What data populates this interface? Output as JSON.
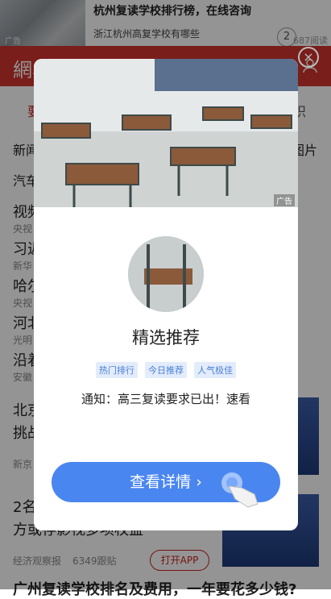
{
  "top_ad": {
    "title": "杭州复读学校排行榜，在线咨询",
    "subtitle": "浙江杭州高复学校有哪些",
    "ad_tag": "广告",
    "read_count": "687阅读",
    "badge_number": "2"
  },
  "header": {
    "logo_text": "網易"
  },
  "tabs": {
    "left_partial": "要",
    "right_partial": "织"
  },
  "channels": {
    "row1_left": "新闻",
    "row1_right": "图片",
    "row2_left": "汽车"
  },
  "feed": {
    "items": [
      {
        "text": "视频",
        "source": "央视"
      },
      {
        "text": "习近",
        "source": "新华"
      },
      {
        "text": "哈尔",
        "source": "央视"
      },
      {
        "text": "河北",
        "source": "光明"
      },
      {
        "text": "沿着",
        "source": "安徽"
      }
    ],
    "article1": {
      "line1": "北京",
      "line2": "挑战",
      "source": "新京"
    },
    "article2": {
      "line1": "2名",
      "line2": "方或存影视多项权益",
      "source": "经济观察报",
      "follow": "6349跟贴",
      "open_app": "打开APP"
    },
    "bottom_title": "广州复读学校排名及费用，一年要花多少钱?"
  },
  "modal": {
    "ad_tag": "广告",
    "title": "精选推荐",
    "tags": [
      "热门排行",
      "今日推荐",
      "人气极佳"
    ],
    "notice": "通知：高三复读要求已出！速看",
    "cta_label": "查看详情"
  },
  "colors": {
    "header": "#d0352e",
    "cta": "#4a86f0",
    "tag_bg": "#e3ecfb",
    "tag_text": "#4a7fd8"
  }
}
